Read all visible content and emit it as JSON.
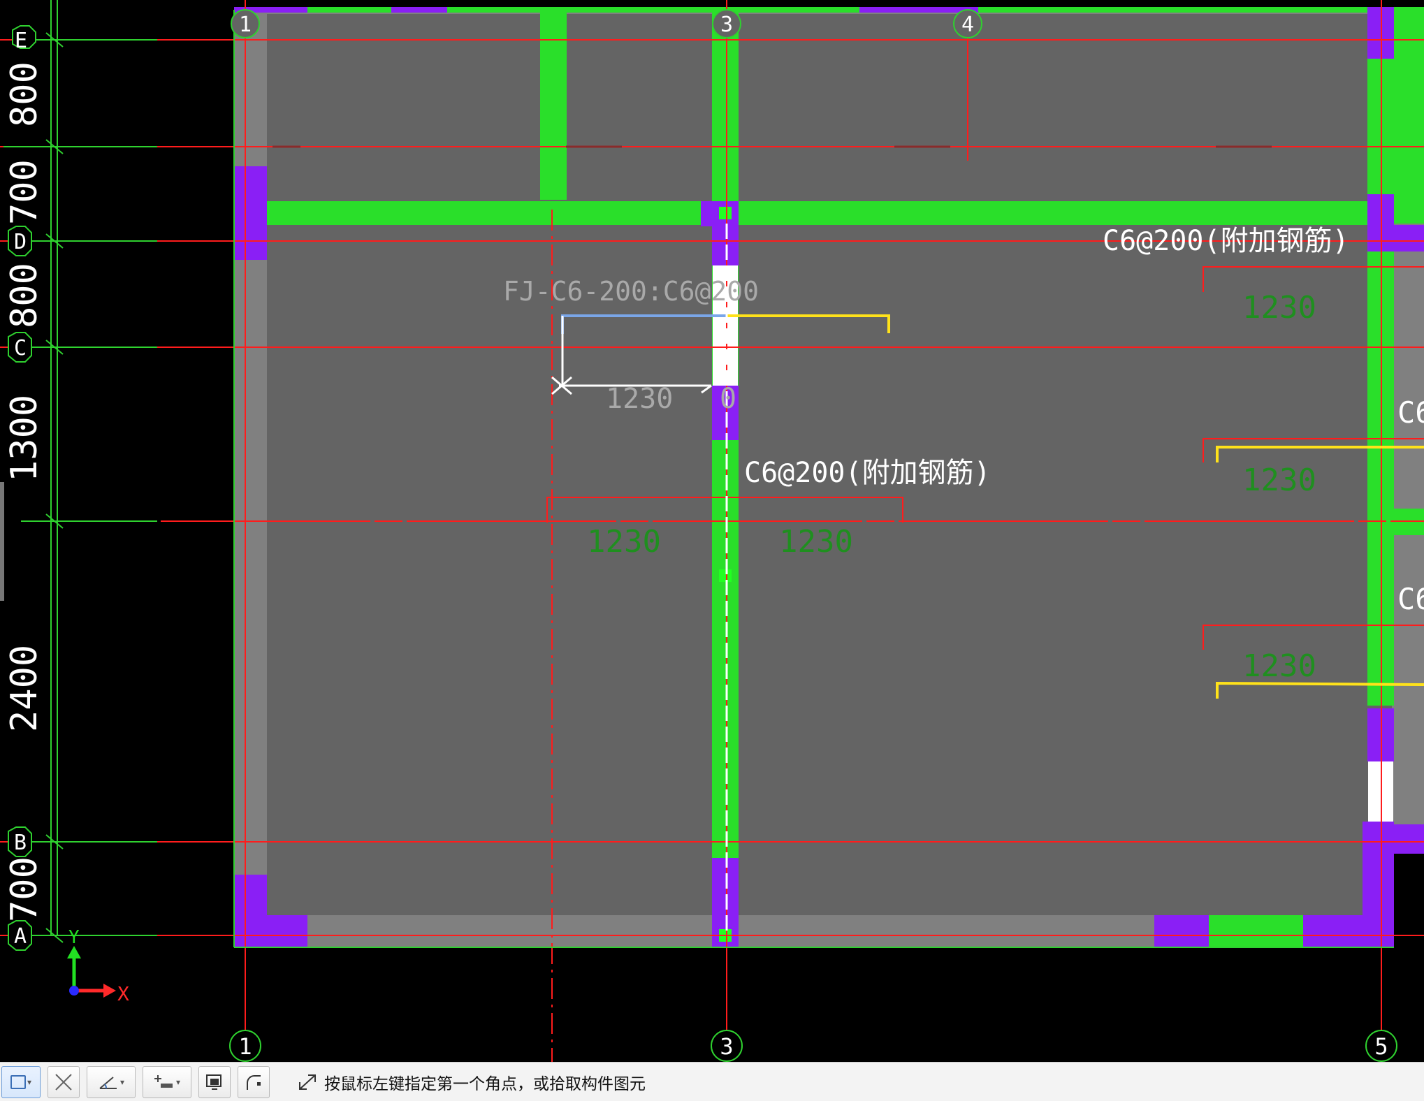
{
  "grid_labels": {
    "top": [
      "1",
      "3",
      "4"
    ],
    "bottom": [
      "1",
      "3",
      "5"
    ],
    "left": [
      "E",
      "D",
      "C",
      "B",
      "A"
    ]
  },
  "dimensions_left": [
    "800",
    "700",
    "800",
    "1300",
    "2400",
    "700"
  ],
  "annotations": {
    "fj_label": "FJ-C6-200:C6@200",
    "rebar_labels": [
      "C6@200(附加钢筋)",
      "C6@200(附加钢筋)"
    ],
    "cut_labels": [
      "C6",
      "C6"
    ],
    "length_values": [
      "1230",
      "1230",
      "1230",
      "1230",
      "1230",
      "1230"
    ],
    "zero_label": "0"
  },
  "axis": {
    "x": "X",
    "y": "Y"
  },
  "statusbar": {
    "prompt_text": "按鼠标左键指定第一个角点，或拾取构件图元",
    "tools": [
      "rect-select-tool",
      "cross-select-tool",
      "angle-tool",
      "line-tool",
      "screen-select-tool",
      "arc-tool"
    ]
  },
  "colors": {
    "background": "#000000",
    "slab": "#646464",
    "beam": "#2adf2a",
    "column": "#8a1ff5",
    "grid_line": "#ff1c1c",
    "dim_line": "#2fd12f",
    "rebar_yellow": "#ffe21a",
    "rebar_blue": "#7aa6e8",
    "length_text": "#1f8f1f"
  }
}
